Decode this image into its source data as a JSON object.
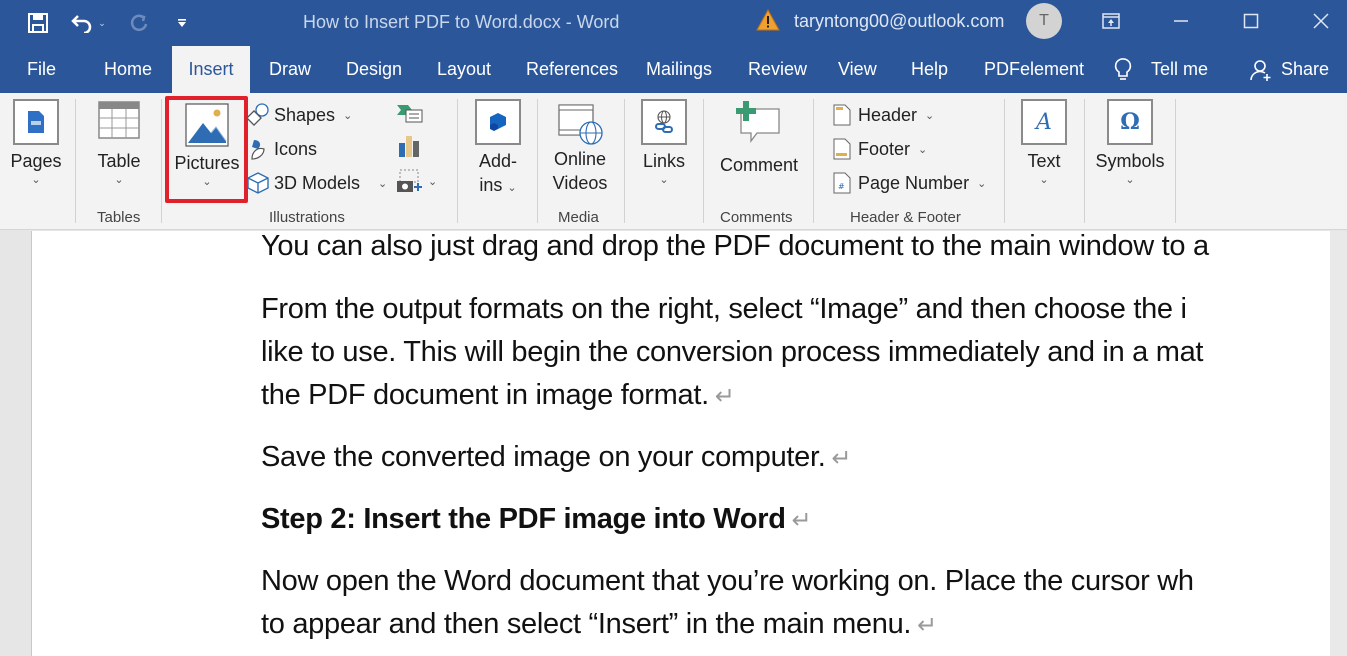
{
  "window": {
    "document_title": "How to Insert PDF to Word.docx  -  Word",
    "account_email": "taryntong00@outlook.com",
    "avatar_initial": "T",
    "accent_color": "#2b579a",
    "highlight_color": "#e0202a"
  },
  "quick_access": {
    "save_icon": "save-icon",
    "undo_icon": "undo-icon",
    "redo_icon": "redo-icon",
    "customize_icon": "customize-qat-icon"
  },
  "tabs": [
    {
      "label": "File"
    },
    {
      "label": "Home"
    },
    {
      "label": "Insert",
      "active": true
    },
    {
      "label": "Draw"
    },
    {
      "label": "Design"
    },
    {
      "label": "Layout"
    },
    {
      "label": "References"
    },
    {
      "label": "Mailings"
    },
    {
      "label": "Review"
    },
    {
      "label": "View"
    },
    {
      "label": "Help"
    },
    {
      "label": "PDFelement"
    }
  ],
  "tell_me": "Tell me",
  "share": "Share",
  "ribbon": {
    "pages": {
      "label": "Pages"
    },
    "table": {
      "label": "Table",
      "group": "Tables"
    },
    "illustrations": {
      "group": "Illustrations",
      "pictures": "Pictures",
      "shapes": "Shapes",
      "icons": "Icons",
      "models": "3D Models"
    },
    "addins": {
      "label1": "Add-",
      "label2": "ins"
    },
    "media": {
      "label1": "Online",
      "label2": "Videos",
      "group": "Media"
    },
    "links": {
      "label": "Links"
    },
    "comments": {
      "label": "Comment",
      "group": "Comments"
    },
    "header_footer": {
      "group": "Header & Footer",
      "header": "Header",
      "footer": "Footer",
      "page_number": "Page Number"
    },
    "text": {
      "label": "Text"
    },
    "symbols": {
      "label": "Symbols"
    }
  },
  "document": {
    "paragraphs": [
      {
        "text": "You can also just drag and drop the PDF document to the main window to a",
        "mark": false
      },
      {
        "text": "From the output formats on the right, select “Image” and then choose the i",
        "mark": false
      },
      {
        "text": "like to use. This will begin the conversion process immediately and in a mat",
        "mark": false
      },
      {
        "text": "the PDF document in image format.",
        "mark": true
      },
      {
        "text": "Save the converted image on your computer.",
        "mark": true
      },
      {
        "text": "Step 2: Insert the PDF image into Word",
        "mark": true,
        "bold": true
      },
      {
        "text": "Now open the Word document that you’re working on. Place the cursor wh",
        "mark": false
      },
      {
        "text": "to appear and then select “Insert” in the main menu.",
        "mark": true
      }
    ],
    "paragraph_mark": "↵"
  }
}
